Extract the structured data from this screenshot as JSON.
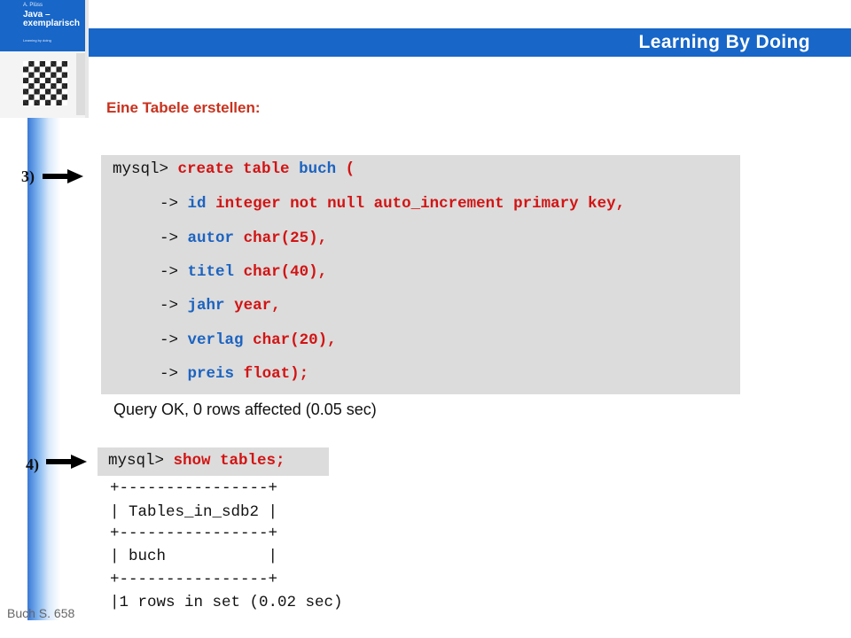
{
  "banner": {
    "title": "Learning By Doing"
  },
  "book": {
    "author": "A. Plüss",
    "title_line1": "Java –",
    "title_line2": "exemplarisch",
    "subtitle": "Learning by doing"
  },
  "heading": "Eine Tabele erstellen:",
  "steps": {
    "step3": "3)",
    "step4": "4)"
  },
  "create_block": {
    "prompt": "mysql>",
    "cont": "->",
    "l1": {
      "kw1": "create table",
      "name": "buch",
      "kw2": "("
    },
    "l2": {
      "name": "id",
      "kw": "integer not null auto_increment primary key,"
    },
    "l3": {
      "name": "autor",
      "kw": "char(25),"
    },
    "l4": {
      "name": "titel",
      "kw": "char(40),"
    },
    "l5": {
      "name": "jahr",
      "kw": "year,"
    },
    "l6": {
      "name": "verlag",
      "kw": "char(20),"
    },
    "l7": {
      "name": "preis",
      "kw": "float);"
    }
  },
  "create_status": "Query OK, 0 rows affected (0.05 sec)",
  "show_block": {
    "prompt": "mysql>",
    "command": "show tables;"
  },
  "show_output": [
    "+----------------+",
    "| Tables_in_sdb2 |",
    "+----------------+",
    "| buch           |",
    "+----------------+",
    "|1 rows in set (0.02 sec)"
  ],
  "footer": "Buch S. 658"
}
